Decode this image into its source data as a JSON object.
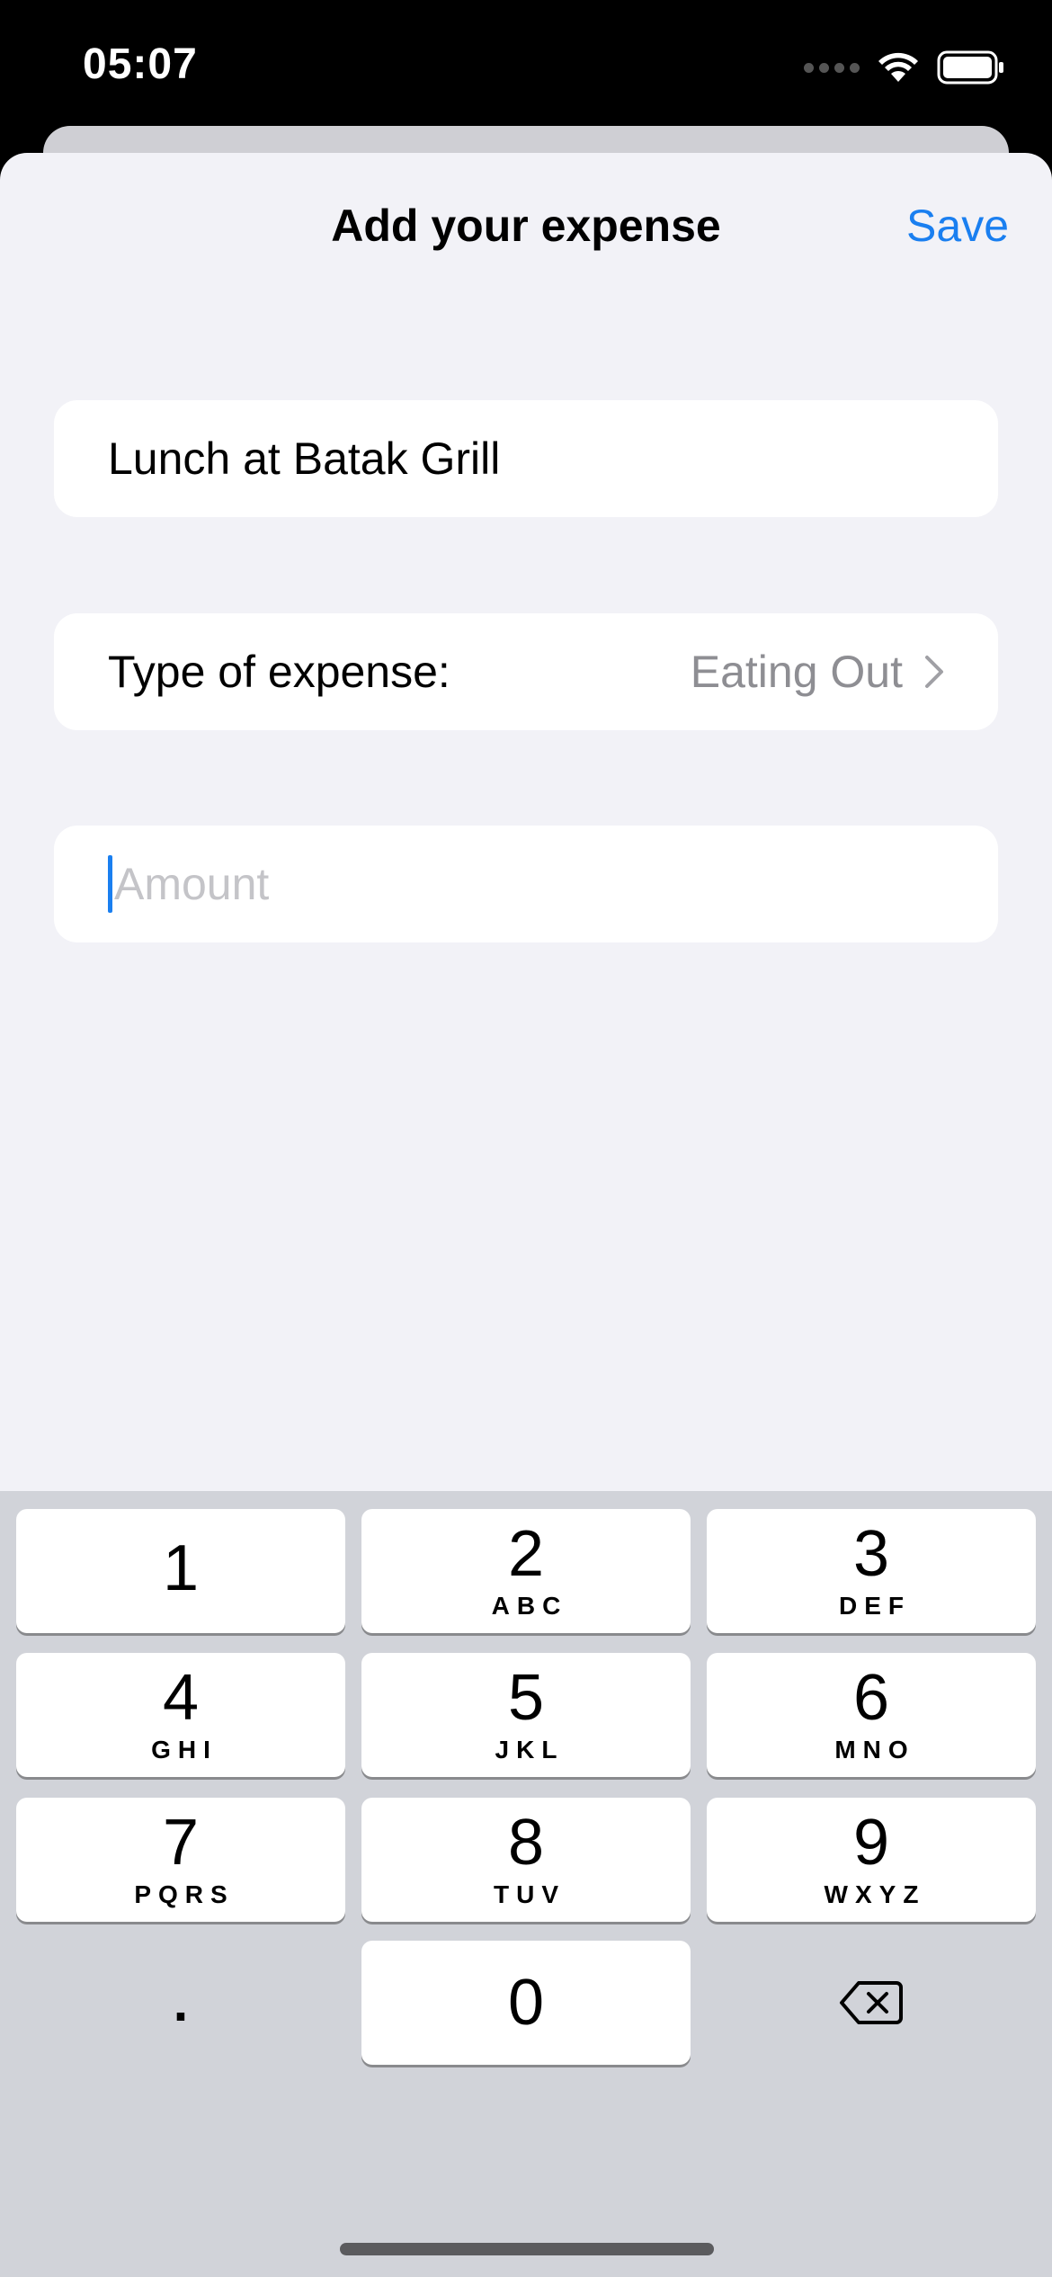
{
  "status": {
    "time": "05:07"
  },
  "nav": {
    "title": "Add your expense",
    "save_label": "Save"
  },
  "form": {
    "name_value": "Lunch at Batak Grill",
    "type_label": "Type of expense:",
    "type_value": "Eating Out",
    "amount_value": "",
    "amount_placeholder": "Amount"
  },
  "keypad": {
    "keys": [
      {
        "digit": "1",
        "letters": ""
      },
      {
        "digit": "2",
        "letters": "ABC"
      },
      {
        "digit": "3",
        "letters": "DEF"
      },
      {
        "digit": "4",
        "letters": "GHI"
      },
      {
        "digit": "5",
        "letters": "JKL"
      },
      {
        "digit": "6",
        "letters": "MNO"
      },
      {
        "digit": "7",
        "letters": "PQRS"
      },
      {
        "digit": "8",
        "letters": "TUV"
      },
      {
        "digit": "9",
        "letters": "WXYZ"
      },
      {
        "digit": ".",
        "letters": ""
      },
      {
        "digit": "0",
        "letters": ""
      }
    ]
  },
  "colors": {
    "accent": "#1a7ff0",
    "sheet_bg": "#f2f2f7",
    "keyboard_bg": "#d1d3d9"
  }
}
